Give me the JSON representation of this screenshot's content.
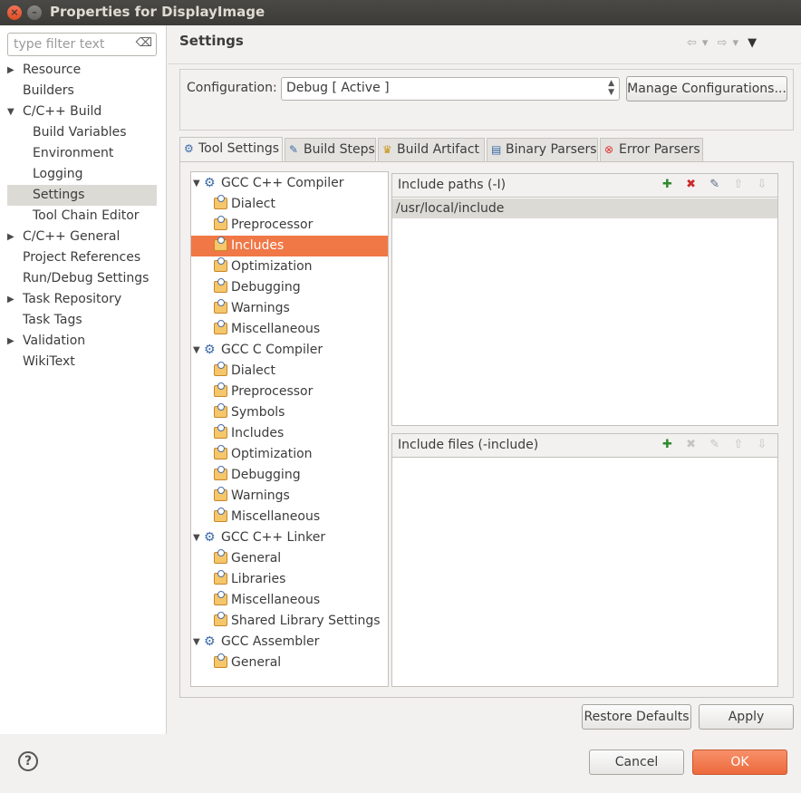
{
  "window": {
    "title": "Properties for DisplayImage"
  },
  "filter": {
    "placeholder": "type filter text"
  },
  "nav": {
    "items": [
      {
        "label": "Resource",
        "arrow": "▶"
      },
      {
        "label": "Builders"
      },
      {
        "label": "C/C++ Build",
        "arrow": "▼"
      },
      {
        "label": "Build Variables"
      },
      {
        "label": "Environment"
      },
      {
        "label": "Logging"
      },
      {
        "label": "Settings"
      },
      {
        "label": "Tool Chain Editor"
      },
      {
        "label": "C/C++ General",
        "arrow": "▶"
      },
      {
        "label": "Project References"
      },
      {
        "label": "Run/Debug Settings"
      },
      {
        "label": "Task Repository",
        "arrow": "▶"
      },
      {
        "label": "Task Tags"
      },
      {
        "label": "Validation",
        "arrow": "▶"
      },
      {
        "label": "WikiText"
      }
    ]
  },
  "header": {
    "title": "Settings"
  },
  "config": {
    "label": "Configuration:",
    "value": "Debug  [ Active ]",
    "manage_label": "Manage Configurations..."
  },
  "tabs": [
    {
      "label": "Tool Settings"
    },
    {
      "label": "Build Steps"
    },
    {
      "label": "Build Artifact"
    },
    {
      "label": "Binary Parsers"
    },
    {
      "label": "Error Parsers"
    }
  ],
  "tooltree": [
    {
      "label": "GCC C++ Compiler"
    },
    {
      "label": "Dialect"
    },
    {
      "label": "Preprocessor"
    },
    {
      "label": "Includes"
    },
    {
      "label": "Optimization"
    },
    {
      "label": "Debugging"
    },
    {
      "label": "Warnings"
    },
    {
      "label": "Miscellaneous"
    },
    {
      "label": "GCC C Compiler"
    },
    {
      "label": "Dialect"
    },
    {
      "label": "Preprocessor"
    },
    {
      "label": "Symbols"
    },
    {
      "label": "Includes"
    },
    {
      "label": "Optimization"
    },
    {
      "label": "Debugging"
    },
    {
      "label": "Warnings"
    },
    {
      "label": "Miscellaneous"
    },
    {
      "label": "GCC C++ Linker"
    },
    {
      "label": "General"
    },
    {
      "label": "Libraries"
    },
    {
      "label": "Miscellaneous"
    },
    {
      "label": "Shared Library Settings"
    },
    {
      "label": "GCC Assembler"
    },
    {
      "label": "General"
    }
  ],
  "include_paths": {
    "title": "Include paths (-I)",
    "rows": [
      "/usr/local/include"
    ]
  },
  "include_files": {
    "title": "Include files (-include)"
  },
  "buttons": {
    "restore": "Restore Defaults",
    "apply": "Apply",
    "cancel": "Cancel",
    "ok": "OK",
    "help": "?"
  },
  "colors": {
    "accent": "#f07746",
    "titlebar": "#3c3b37"
  }
}
